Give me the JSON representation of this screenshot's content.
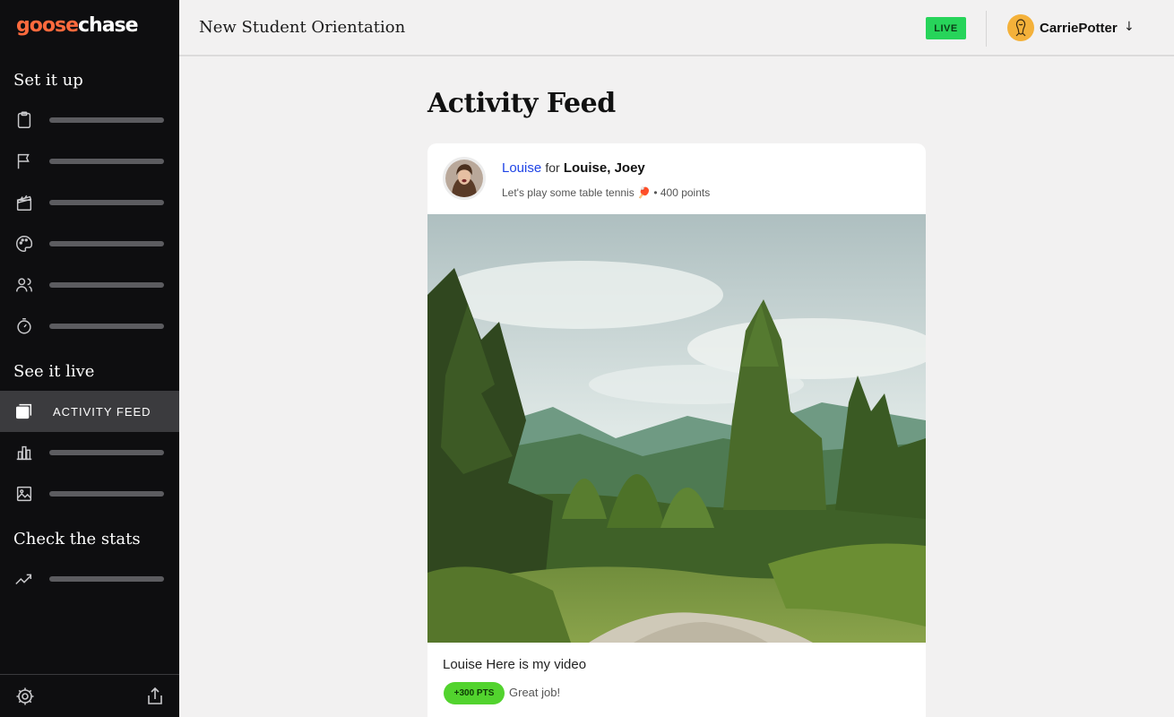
{
  "app": {
    "logo_part1": "goose",
    "logo_part2": "chase",
    "brand_color": "#ff6a3d"
  },
  "sidebar": {
    "section_setup": "Set it up",
    "section_live": "See it live",
    "section_stats": "Check the stats",
    "setup_items": [
      {
        "icon": "clipboard-icon"
      },
      {
        "icon": "flag-icon"
      },
      {
        "icon": "clapperboard-icon"
      },
      {
        "icon": "palette-icon"
      },
      {
        "icon": "users-icon"
      },
      {
        "icon": "stopwatch-icon"
      }
    ],
    "live_items": [
      {
        "icon": "feed-icon",
        "label": "ACTIVITY FEED",
        "active": true
      },
      {
        "icon": "bar-chart-icon"
      },
      {
        "icon": "image-icon"
      }
    ],
    "stats_items": [
      {
        "icon": "trend-icon"
      }
    ],
    "bottom": {
      "settings_icon": "gear-icon",
      "share_icon": "share-icon"
    }
  },
  "header": {
    "title": "New Student Orientation",
    "status": "LIVE",
    "status_color": "#27d45a",
    "user_name": "CarriePotter",
    "user_menu_arrow": "↓"
  },
  "main": {
    "title": "Activity Feed",
    "post": {
      "author": "Louise",
      "for_word": "for",
      "team": "Louise, Joey",
      "mission": "Let's play some table tennis 🏓 • 400 points",
      "caption_author": "Louise",
      "caption_text": "Here is my video",
      "points_badge": "+300 PTS",
      "comment": "Great job!"
    }
  }
}
